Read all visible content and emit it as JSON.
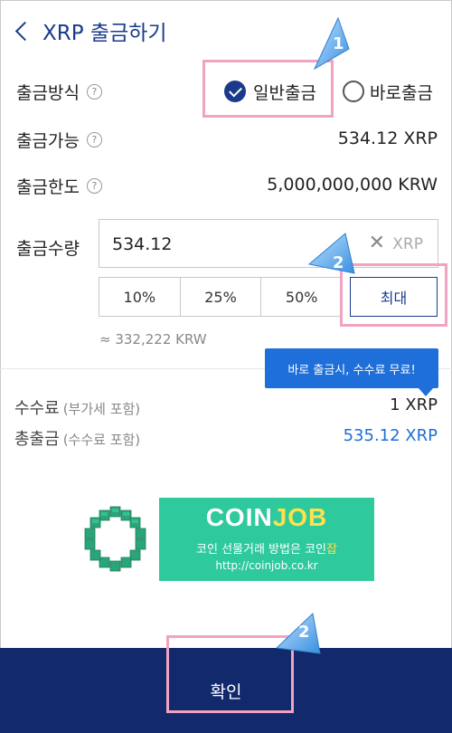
{
  "header": {
    "title": "XRP 출금하기"
  },
  "method": {
    "label": "출금방식",
    "options": [
      {
        "label": "일반출금",
        "selected": true
      },
      {
        "label": "바로출금",
        "selected": false
      }
    ]
  },
  "available": {
    "label": "출금가능",
    "value": "534.12 XRP"
  },
  "limit": {
    "label": "출금한도",
    "value": "5,000,000,000 KRW"
  },
  "amount": {
    "label": "출금수량",
    "value": "534.12",
    "unit": "XRP",
    "clear_glyph": "✕",
    "percent_buttons": [
      "10%",
      "25%",
      "50%"
    ],
    "max_label": "최대",
    "approx": "≈ 332,222 KRW"
  },
  "tooltip": {
    "text": "바로 출금시, 수수료 무료!"
  },
  "fee": {
    "label": "수수료",
    "sub": "(부가세 포함)",
    "value": "1 XRP"
  },
  "total": {
    "label": "총출금",
    "sub": "(수수료 포함)",
    "value": "535.12 XRP",
    "color": "#1e6fd9"
  },
  "banner": {
    "title_main": "COIN",
    "title_accent": "JOB",
    "slogan_main": "코인 선물거래 방법은 코인",
    "slogan_accent": "잡",
    "url": "http://coinjob.co.kr",
    "bg_color": "#2ec99d",
    "accent_color": "#ffe14a"
  },
  "confirm": {
    "label": "확인",
    "bg_color": "#12296b"
  },
  "callouts": {
    "one": "1",
    "two": "2"
  },
  "colors": {
    "brand_navy": "#1b3a8c",
    "highlight_pink": "#f0a3c2",
    "link_blue": "#1e6fd9"
  }
}
